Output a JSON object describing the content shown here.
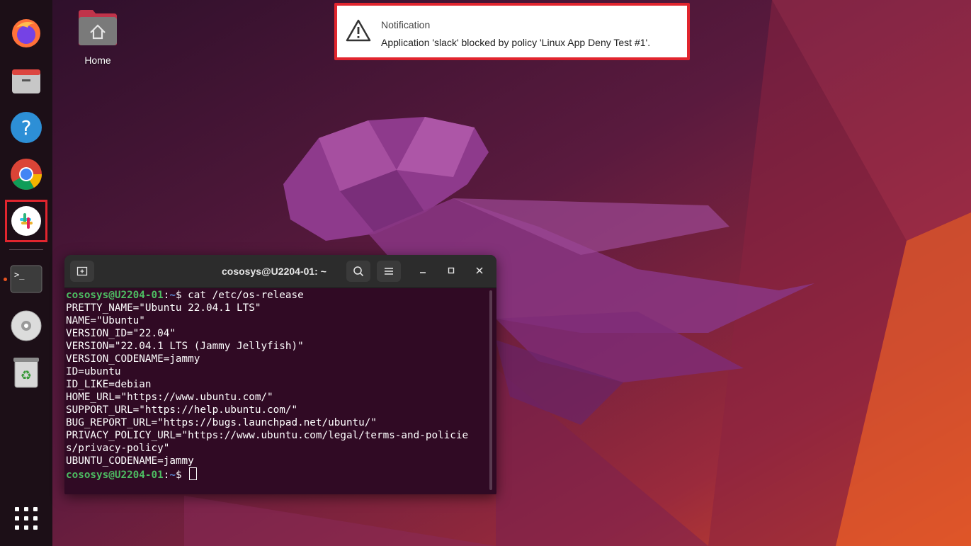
{
  "desktop": {
    "home_label": "Home"
  },
  "notification": {
    "title": "Notification",
    "message": "Application 'slack' blocked by policy 'Linux App Deny Test #1'.",
    "icon": "warning-icon"
  },
  "dock": {
    "items": [
      {
        "name": "Firefox",
        "icon": "firefox-icon"
      },
      {
        "name": "Files",
        "icon": "files-icon"
      },
      {
        "name": "Help",
        "icon": "help-icon"
      },
      {
        "name": "Google Chrome",
        "icon": "chrome-icon"
      },
      {
        "name": "Slack",
        "icon": "slack-icon",
        "highlighted": true
      },
      {
        "name": "Terminal",
        "icon": "terminal-icon",
        "running": true
      },
      {
        "name": "Disc",
        "icon": "disc-icon"
      },
      {
        "name": "Trash",
        "icon": "trash-icon"
      },
      {
        "name": "Show Applications",
        "icon": "app-grid-icon"
      }
    ],
    "accent_running": "#e95420",
    "highlight_color": "#e1252e"
  },
  "terminal": {
    "title": "cososys@U2204-01: ~",
    "prompt_user": "cososys@U2204-01",
    "prompt_sep": ":",
    "prompt_path": "~",
    "prompt_symbol": "$ ",
    "command": "cat /etc/os-release",
    "output": [
      "PRETTY_NAME=\"Ubuntu 22.04.1 LTS\"",
      "NAME=\"Ubuntu\"",
      "VERSION_ID=\"22.04\"",
      "VERSION=\"22.04.1 LTS (Jammy Jellyfish)\"",
      "VERSION_CODENAME=jammy",
      "ID=ubuntu",
      "ID_LIKE=debian",
      "HOME_URL=\"https://www.ubuntu.com/\"",
      "SUPPORT_URL=\"https://help.ubuntu.com/\"",
      "BUG_REPORT_URL=\"https://bugs.launchpad.net/ubuntu/\"",
      "PRIVACY_POLICY_URL=\"https://www.ubuntu.com/legal/terms-and-policie",
      "s/privacy-policy\"",
      "UBUNTU_CODENAME=jammy"
    ],
    "colors": {
      "background": "#300a24",
      "user": "#4dbd62",
      "path": "#5b8bd6"
    }
  }
}
